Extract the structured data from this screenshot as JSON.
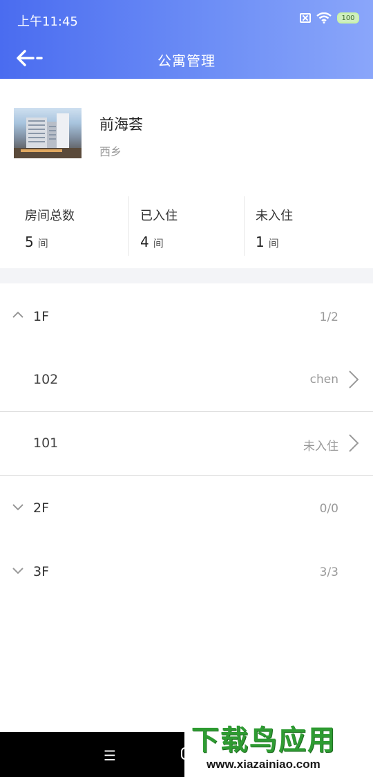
{
  "status_bar": {
    "time": "上午11:45",
    "battery": "100"
  },
  "nav": {
    "title": "公寓管理"
  },
  "apartment": {
    "name": "前海荟",
    "area": "西乡"
  },
  "stats": [
    {
      "label": "房间总数",
      "value": "5",
      "unit": "间"
    },
    {
      "label": "已入住",
      "value": "4",
      "unit": "间"
    },
    {
      "label": "未入住",
      "value": "1",
      "unit": "间"
    }
  ],
  "floors": [
    {
      "label": "1F",
      "count": "1/2",
      "expanded": true,
      "rooms": [
        {
          "number": "102",
          "status": "chen"
        },
        {
          "number": "101",
          "status": "未入住"
        }
      ]
    },
    {
      "label": "2F",
      "count": "0/0",
      "expanded": false
    },
    {
      "label": "3F",
      "count": "3/3",
      "expanded": false
    }
  ],
  "watermark": {
    "title": "下载鸟应用",
    "url": "www.xiazainiao.com"
  },
  "colors": {
    "header_start": "#4a6cf0",
    "header_end": "#8aa6fa",
    "watermark_green": "#2e9b32"
  }
}
